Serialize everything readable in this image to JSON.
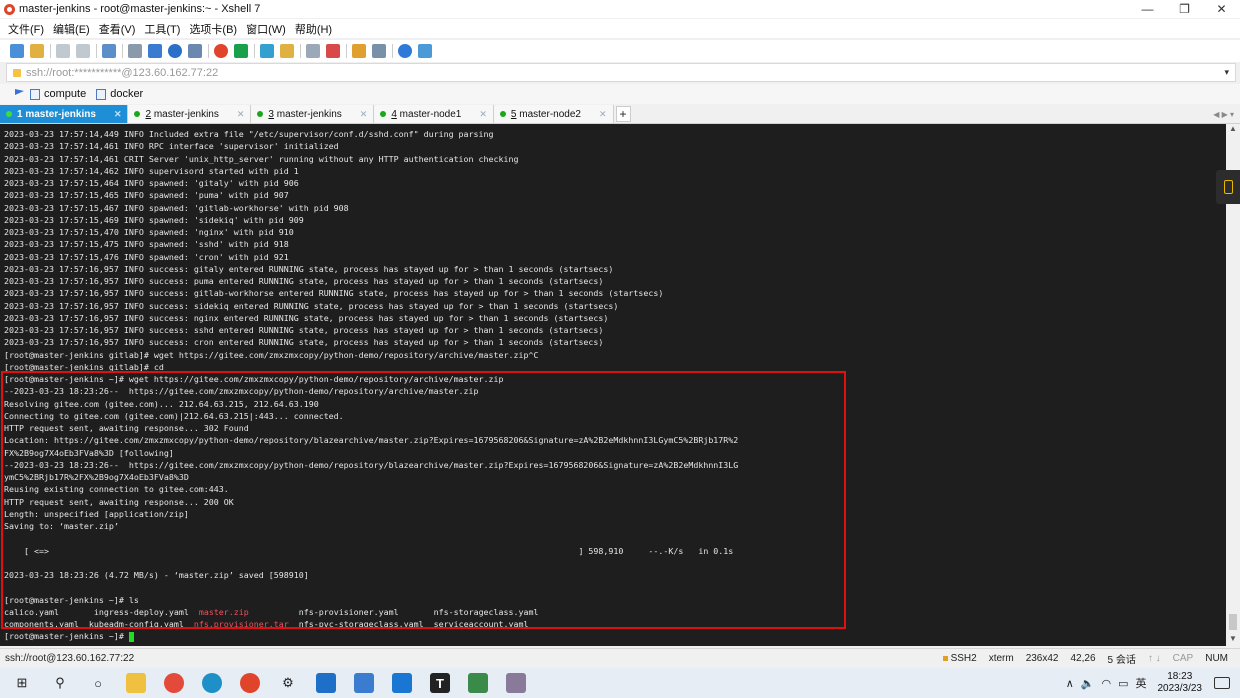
{
  "window": {
    "title": "master-jenkins - root@master-jenkins:~ - Xshell 7",
    "minimize": "—",
    "maximize": "❐",
    "close": "✕"
  },
  "menu": [
    "文件(F)",
    "编辑(E)",
    "查看(V)",
    "工具(T)",
    "选项卡(B)",
    "窗口(W)",
    "帮助(H)"
  ],
  "address": {
    "value": "ssh://root:***********@123.60.162.77:22",
    "dropdown": "▾"
  },
  "links": [
    "compute",
    "docker"
  ],
  "tabs": [
    {
      "num": "1",
      "label": "master-jenkins",
      "active": true
    },
    {
      "num": "2",
      "label": "master-jenkins",
      "active": false
    },
    {
      "num": "3",
      "label": "master-jenkins",
      "active": false
    },
    {
      "num": "4",
      "label": "master-node1",
      "active": false
    },
    {
      "num": "5",
      "label": "master-node2",
      "active": false
    }
  ],
  "tab_add": "+",
  "terminal": {
    "lines": [
      "2023-03-23 17:57:14,449 INFO Included extra file \"/etc/supervisor/conf.d/sshd.conf\" during parsing",
      "2023-03-23 17:57:14,461 INFO RPC interface 'supervisor' initialized",
      "2023-03-23 17:57:14,461 CRIT Server 'unix_http_server' running without any HTTP authentication checking",
      "2023-03-23 17:57:14,462 INFO supervisord started with pid 1",
      "2023-03-23 17:57:15,464 INFO spawned: 'gitaly' with pid 906",
      "2023-03-23 17:57:15,465 INFO spawned: 'puma' with pid 907",
      "2023-03-23 17:57:15,467 INFO spawned: 'gitlab-workhorse' with pid 908",
      "2023-03-23 17:57:15,469 INFO spawned: 'sidekiq' with pid 909",
      "2023-03-23 17:57:15,470 INFO spawned: 'nginx' with pid 910",
      "2023-03-23 17:57:15,475 INFO spawned: 'sshd' with pid 918",
      "2023-03-23 17:57:15,476 INFO spawned: 'cron' with pid 921",
      "2023-03-23 17:57:16,957 INFO success: gitaly entered RUNNING state, process has stayed up for > than 1 seconds (startsecs)",
      "2023-03-23 17:57:16,957 INFO success: puma entered RUNNING state, process has stayed up for > than 1 seconds (startsecs)",
      "2023-03-23 17:57:16,957 INFO success: gitlab-workhorse entered RUNNING state, process has stayed up for > than 1 seconds (startsecs)",
      "2023-03-23 17:57:16,957 INFO success: sidekiq entered RUNNING state, process has stayed up for > than 1 seconds (startsecs)",
      "2023-03-23 17:57:16,957 INFO success: nginx entered RUNNING state, process has stayed up for > than 1 seconds (startsecs)",
      "2023-03-23 17:57:16,957 INFO success: sshd entered RUNNING state, process has stayed up for > than 1 seconds (startsecs)",
      "2023-03-23 17:57:16,957 INFO success: cron entered RUNNING state, process has stayed up for > than 1 seconds (startsecs)",
      "[root@master-jenkins gitlab]# wget https://gitee.com/zmxzmxcopy/python-demo/repository/archive/master.zip^C",
      "[root@master-jenkins gitlab]# cd",
      "[root@master-jenkins ~]# wget https://gitee.com/zmxzmxcopy/python-demo/repository/archive/master.zip",
      "--2023-03-23 18:23:26--  https://gitee.com/zmxzmxcopy/python-demo/repository/archive/master.zip",
      "Resolving gitee.com (gitee.com)... 212.64.63.215, 212.64.63.190",
      "Connecting to gitee.com (gitee.com)|212.64.63.215|:443... connected.",
      "HTTP request sent, awaiting response... 302 Found",
      "Location: https://gitee.com/zmxzmxcopy/python-demo/repository/blazearchive/master.zip?Expires=1679568206&Signature=zA%2B2eMdkhnnI3LGymC5%2BRjb17R%2",
      "FX%2B9og7X4oEb3FVa8%3D [following]",
      "--2023-03-23 18:23:26--  https://gitee.com/zmxzmxcopy/python-demo/repository/blazearchive/master.zip?Expires=1679568206&Signature=zA%2B2eMdkhnnI3LG",
      "ymC5%2BRjb17R%2FX%2B9og7X4oEb3FVa8%3D",
      "Reusing existing connection to gitee.com:443.",
      "HTTP request sent, awaiting response... 200 OK",
      "Length: unspecified [application/zip]",
      "Saving to: ‘master.zip’",
      "",
      "    [ <=>                                                                                                          ] 598,910     --.-K/s   in 0.1s",
      "",
      "2023-03-23 18:23:26 (4.72 MB/s) - ‘master.zip’ saved [598910]",
      "",
      "[root@master-jenkins ~]# ls"
    ],
    "ls_rows": [
      [
        {
          "text": "calico.yaml       ",
          "red": false
        },
        {
          "text": "ingress-deploy.yaml  ",
          "red": false
        },
        {
          "text": "master.zip          ",
          "red": true
        },
        {
          "text": "nfs-provisioner.yaml       ",
          "red": false
        },
        {
          "text": "nfs-storageclass.yaml",
          "red": false
        }
      ],
      [
        {
          "text": "components.yaml  ",
          "red": false
        },
        {
          "text": "kubeadm-config.yaml  ",
          "red": false
        },
        {
          "text": "nfs.provisioner.tar",
          "red": true
        },
        {
          "text": "  nfs-pvc-storageclass.yaml  ",
          "red": false
        },
        {
          "text": "serviceaccount.yaml",
          "red": false
        }
      ]
    ],
    "prompt": "[root@master-jenkins ~]# "
  },
  "status": {
    "left": "ssh://root@123.60.162.77:22",
    "protocol": "SSH2",
    "term": "xterm",
    "size": "236x42",
    "pos": "42,26",
    "sessions": "5 会话",
    "cap": "CAP",
    "num": "NUM"
  },
  "tray": {
    "lang": "英",
    "time": "18:23",
    "date": "2023/3/23"
  },
  "colors": {
    "terminal_bg": "#1e1e1e",
    "active_tab": "#1e8fd6",
    "highlight_box": "#e01010",
    "archive_text": "#f0505a",
    "cursor": "#22dd22"
  }
}
